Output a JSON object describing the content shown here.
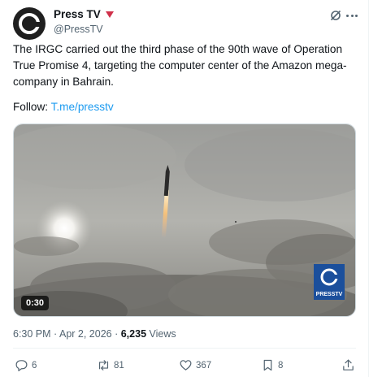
{
  "author": {
    "display_name": "Press TV",
    "handle": "@PressTV"
  },
  "tweet": {
    "text": "The IRGC carried out the third phase of the 90th wave of Operation True Promise 4, targeting the computer center of the Amazon mega-company in Bahrain.",
    "follow_label": "Follow: ",
    "follow_link": "T.me/presstv"
  },
  "media": {
    "duration": "0:30",
    "logo_text": "PRESSTV"
  },
  "meta": {
    "time": "6:30 PM",
    "separator": " · ",
    "date": "Apr 2, 2026",
    "views": "6,235",
    "views_label": " Views"
  },
  "actions": {
    "replies": "6",
    "reposts": "81",
    "likes": "367",
    "bookmarks": "8"
  },
  "colors": {
    "accent": "#1d9bf0",
    "secondary_text": "#536471",
    "brand_flag": "#d0314a"
  }
}
